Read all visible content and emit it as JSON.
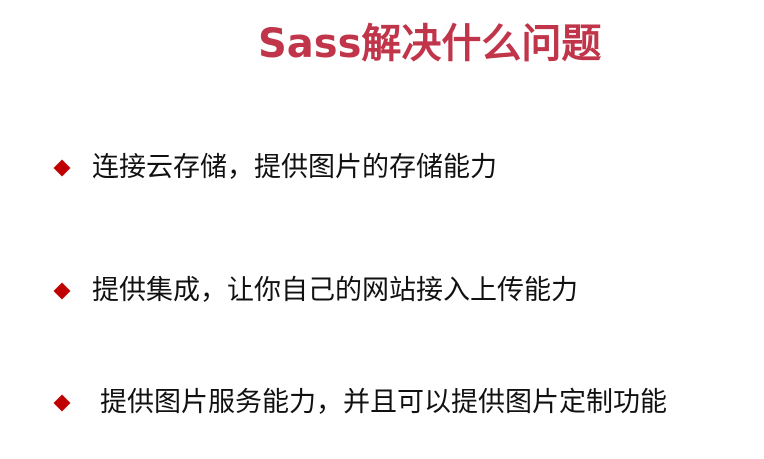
{
  "slide": {
    "title": "Sass解决什么问题",
    "bullets": [
      {
        "text": "连接云存储，提供图片的存储能力"
      },
      {
        "text": "提供集成，让你自己的网站接入上传能力"
      },
      {
        "text": "提供图片服务能力，并且可以提供图片定制功能"
      }
    ],
    "colors": {
      "title": "#c0354a",
      "bullet_marker": "#c00000",
      "text": "#111111",
      "background": "#ffffff"
    },
    "icons": {
      "bullet_marker": "diamond-bullet-icon"
    }
  }
}
